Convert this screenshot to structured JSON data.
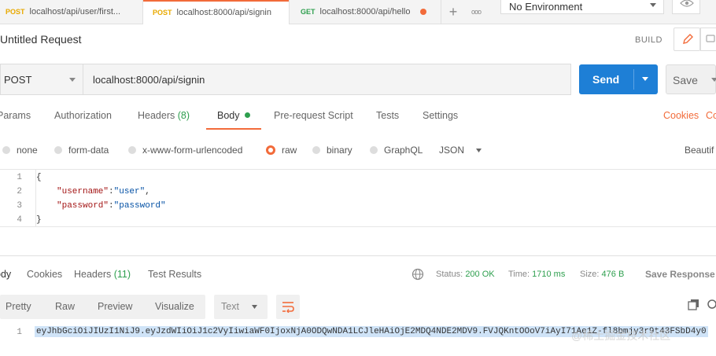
{
  "tabs": [
    {
      "method": "POST",
      "url": "localhost/api/user/first...",
      "active": false
    },
    {
      "method": "POST",
      "url": "localhost:8000/api/signin",
      "active": true
    },
    {
      "method": "GET",
      "url": "localhost:8000/api/hello",
      "active": false
    }
  ],
  "toolbar": {
    "plus": "+",
    "more": "ooo"
  },
  "environment": {
    "selected": "No Environment"
  },
  "request": {
    "title": "Untitled Request",
    "build_label": "BUILD",
    "method": "POST",
    "url": "localhost:8000/api/signin",
    "send_label": "Send",
    "save_label": "Save"
  },
  "request_tabs": {
    "params": "Params",
    "authorization": "Authorization",
    "headers": "Headers",
    "headers_count": "(8)",
    "body": "Body",
    "prerequest": "Pre-request Script",
    "tests": "Tests",
    "settings": "Settings",
    "cookies": "Cookies",
    "code": "Co"
  },
  "body_modes": {
    "none": "none",
    "form_data": "form-data",
    "urlencoded": "x-www-form-urlencoded",
    "raw": "raw",
    "binary": "binary",
    "graphql": "GraphQL",
    "language": "JSON",
    "beautify": "Beautif"
  },
  "code_lines": [
    {
      "num": "1",
      "text": "{"
    },
    {
      "num": "2",
      "key": "\"username\"",
      "sep": ":",
      "value": "\"user\"",
      "trail": ","
    },
    {
      "num": "3",
      "key": "\"password\"",
      "sep": ":",
      "value": "\"password\"",
      "trail": ""
    },
    {
      "num": "4",
      "text": "}"
    }
  ],
  "response": {
    "tabs": {
      "body": "ody",
      "cookies": "Cookies",
      "headers": "Headers",
      "headers_count": "(11)",
      "test_results": "Test Results"
    },
    "status_label": "Status:",
    "status_value": "200 OK",
    "time_label": "Time:",
    "time_value": "1710 ms",
    "size_label": "Size:",
    "size_value": "476 B",
    "save_response": "Save Response",
    "formats": {
      "pretty": "Pretty",
      "raw": "Raw",
      "preview": "Preview",
      "visualize": "Visualize"
    },
    "text_type": "Text",
    "line_number": "1",
    "token": "eyJhbGciOiJIUzI1NiJ9.eyJzdWIiOiJ1c2VyIiwiaWF0IjoxNjA0ODQwNDA1LCJleHAiOjE2MDQ4NDE2MDV9.FVJQKntOOoV7iAyI71Ae1Z-fl8bmjy3r9t43FSbD4y0"
  },
  "watermark": "@稀土掘金技术社区",
  "colors": {
    "accent": "#f26b3a",
    "send": "#1e7fd6",
    "post": "#e8a900",
    "get": "#2e9f4e",
    "status_ok": "#2e9f4e"
  }
}
